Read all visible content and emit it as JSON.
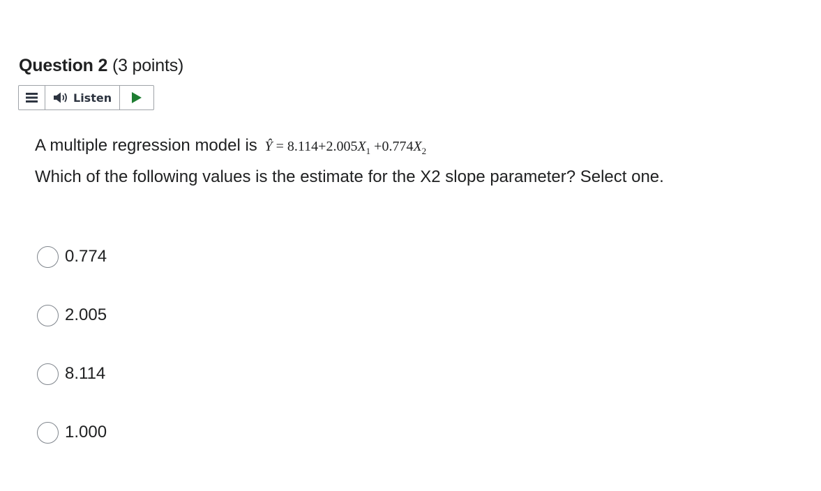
{
  "question": {
    "title": "Question 2",
    "points": "(3 points)"
  },
  "toolbar": {
    "menu_icon": "menu-icon",
    "listen_label": "Listen",
    "speaker_icon": "speaker-icon",
    "play_icon": "play-icon",
    "play_color": "#1e7d32"
  },
  "stem": {
    "line1": "A multiple regression model is",
    "formula": {
      "yhat": "Ŷ",
      "equals": "=",
      "intercept": "8.114",
      "plus1": "+",
      "coef1": "2.005",
      "x1": "X",
      "x1_sub": "1",
      "plus2": "+",
      "coef2": "0.774",
      "x2": "X",
      "x2_sub": "2"
    },
    "line2": "Which of the following values is the estimate for the X2 slope parameter? Select one."
  },
  "options": [
    {
      "label": "0.774",
      "selected": false
    },
    {
      "label": "2.005",
      "selected": false
    },
    {
      "label": "8.114",
      "selected": false
    },
    {
      "label": "1.000",
      "selected": false
    }
  ]
}
